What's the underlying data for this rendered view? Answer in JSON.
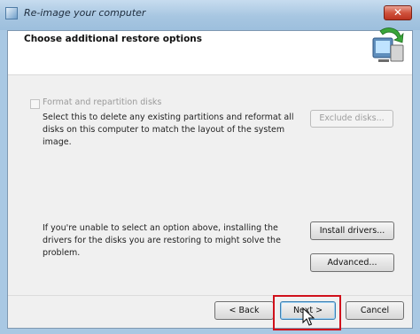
{
  "window": {
    "title": "Re-image your computer",
    "close_glyph": "✕"
  },
  "header": {
    "title": "Choose additional restore options"
  },
  "format_option": {
    "label": "Format and repartition disks",
    "checked": false,
    "enabled": false,
    "description": "Select this to delete any existing partitions and reformat all disks on this computer to match the layout of the system image.",
    "exclude_button": "Exclude disks..."
  },
  "drivers": {
    "description": "If you're unable to select an option above, installing the drivers for the disks you are restoring to might solve the problem.",
    "install_button": "Install drivers...",
    "advanced_button": "Advanced..."
  },
  "footer": {
    "back_button": "< Back",
    "next_button": "Next >",
    "cancel_button": "Cancel"
  },
  "highlight_color": "#d0101b"
}
